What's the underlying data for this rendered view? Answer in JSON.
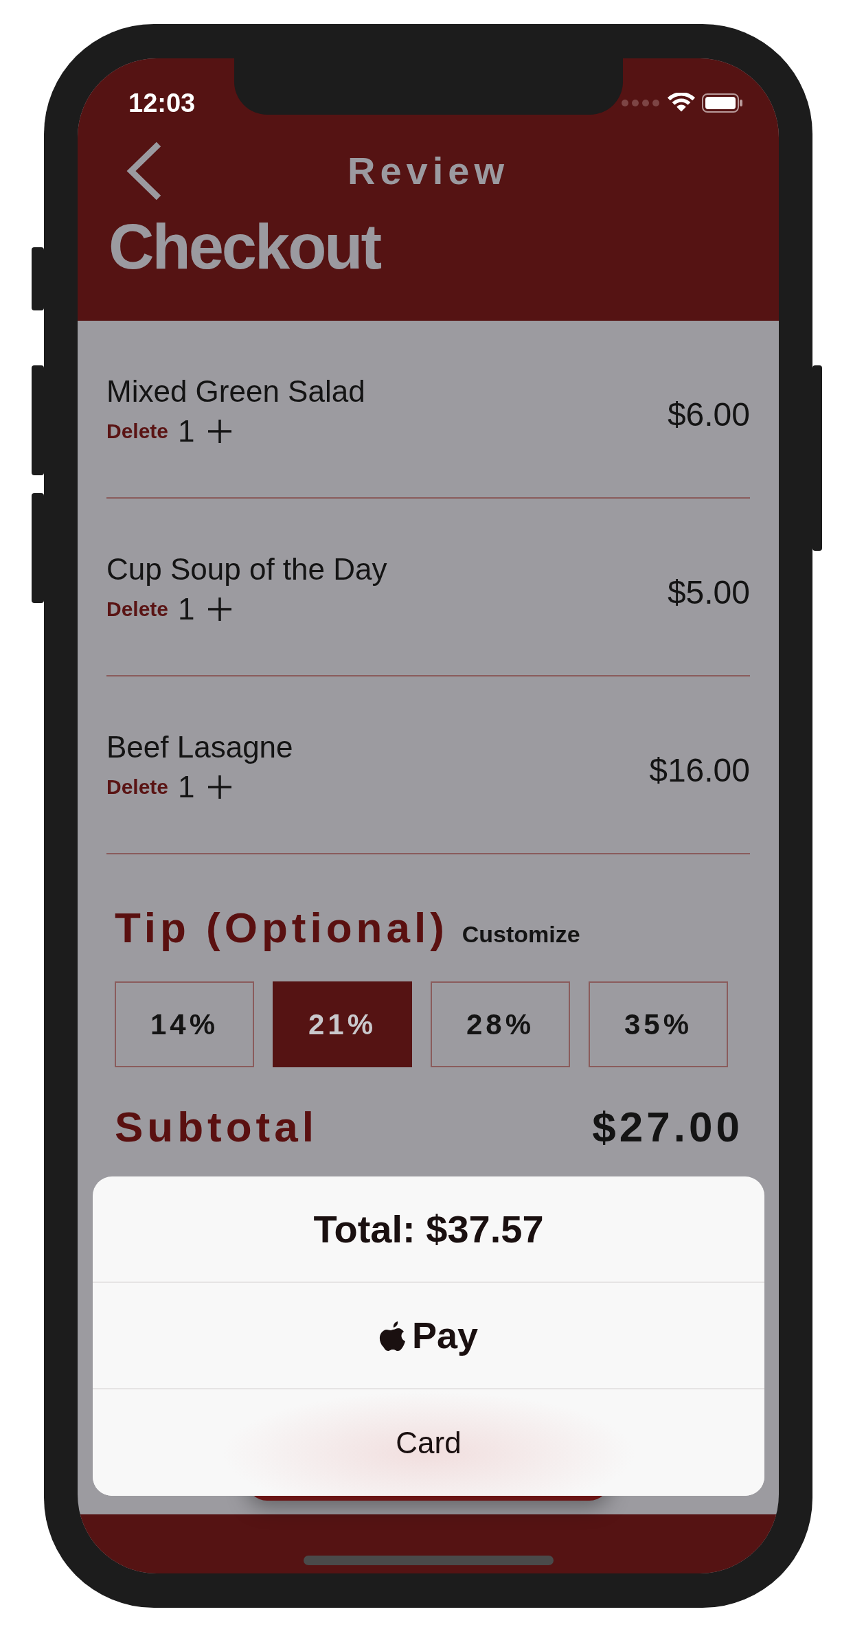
{
  "status_bar": {
    "time": "12:03"
  },
  "nav": {
    "title": "Review"
  },
  "page_title": "Checkout",
  "items": [
    {
      "name": "Mixed Green Salad",
      "delete": "Delete",
      "quantity": "1",
      "price": "$6.00"
    },
    {
      "name": "Cup Soup of the Day",
      "delete": "Delete",
      "quantity": "1",
      "price": "$5.00"
    },
    {
      "name": "Beef Lasagne",
      "delete": "Delete",
      "quantity": "1",
      "price": "$16.00"
    }
  ],
  "tip": {
    "title": "Tip (Optional)",
    "customize": "Customize",
    "options": [
      {
        "label": "14%",
        "selected": false
      },
      {
        "label": "21%",
        "selected": true
      },
      {
        "label": "28%",
        "selected": false
      },
      {
        "label": "35%",
        "selected": false
      }
    ]
  },
  "subtotal": {
    "label": "Subtotal",
    "amount": "$27.00"
  },
  "payment_sheet": {
    "total": "Total: $37.57",
    "options": [
      {
        "kind": "apple_pay",
        "label": "Pay"
      },
      {
        "kind": "card",
        "label": "Card"
      }
    ]
  }
}
